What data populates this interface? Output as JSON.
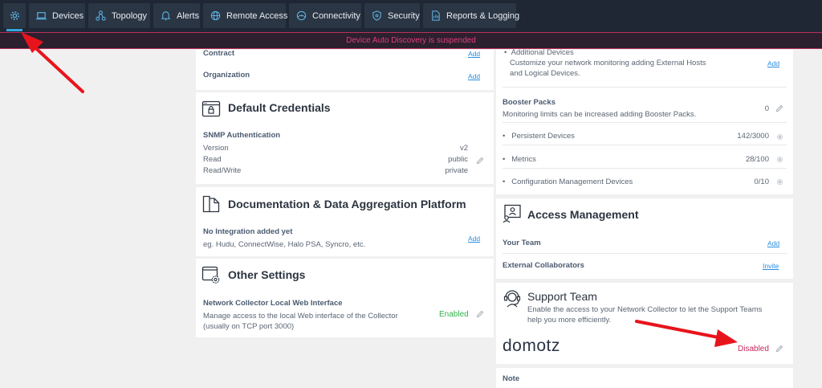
{
  "nav": {
    "settings_icon": "gear-icon",
    "items": [
      {
        "label": "Devices",
        "icon": "laptop-icon"
      },
      {
        "label": "Topology",
        "icon": "topology-icon"
      },
      {
        "label": "Alerts",
        "icon": "bell-icon"
      },
      {
        "label": "Remote Access",
        "icon": "globe-icon"
      },
      {
        "label": "Connectivity",
        "icon": "connectivity-icon"
      },
      {
        "label": "Security",
        "icon": "shield-icon"
      },
      {
        "label": "Reports & Logging",
        "icon": "report-icon"
      }
    ]
  },
  "banner": {
    "text": "Device Auto Discovery is suspended"
  },
  "left": {
    "contract": {
      "label": "Contract",
      "action": "Add"
    },
    "organization": {
      "label": "Organization",
      "action": "Add"
    },
    "default_credentials": {
      "title": "Default Credentials",
      "snmp_label": "SNMP Authentication",
      "rows": [
        {
          "key": "Version",
          "value": "v2"
        },
        {
          "key": "Read",
          "value": "public"
        },
        {
          "key": "Read/Write",
          "value": "private"
        }
      ]
    },
    "documentation": {
      "title": "Documentation & Data Aggregation Platform",
      "label": "No Integration added yet",
      "desc": "eg. Hudu, ConnectWise, Halo PSA, Syncro, etc.",
      "action": "Add"
    },
    "other_settings": {
      "title": "Other Settings",
      "label": "Network Collector Local Web Interface",
      "desc_line1": "Manage access to the local Web interface of the Collector",
      "desc_line2": "(usually on TCP port 3000)",
      "status": "Enabled"
    }
  },
  "right": {
    "additional_devices": {
      "label": "Additional Devices",
      "desc_line1": "Customize your network monitoring adding External Hosts",
      "desc_line2": "and Logical Devices.",
      "action": "Add"
    },
    "booster_packs": {
      "label": "Booster Packs",
      "desc": "Monitoring limits can be increased adding Booster Packs.",
      "count": "0",
      "rows": [
        {
          "label": "Persistent Devices",
          "value": "142/3000"
        },
        {
          "label": "Metrics",
          "value": "28/100"
        },
        {
          "label": "Configuration Management Devices",
          "value": "0/10"
        }
      ]
    },
    "access_management": {
      "title": "Access Management",
      "your_team": {
        "label": "Your Team",
        "action": "Add"
      },
      "external": {
        "label": "External Collaborators",
        "action": "Invite"
      }
    },
    "support_team": {
      "title": "Support Team",
      "desc_line1": "Enable the access to your Network Collector to let the Support Teams",
      "desc_line2": "help you more efficiently.",
      "logo": "domotz",
      "status": "Disabled"
    },
    "note": {
      "label": "Note"
    }
  },
  "colors": {
    "nav_bg": "#1e2733",
    "nav_button": "#2b3644",
    "banner_text": "#e23d7a",
    "link": "#2b8ee0",
    "enabled": "#2fb34a",
    "disabled": "#c8285e",
    "annotation_arrow": "#e8141c"
  }
}
